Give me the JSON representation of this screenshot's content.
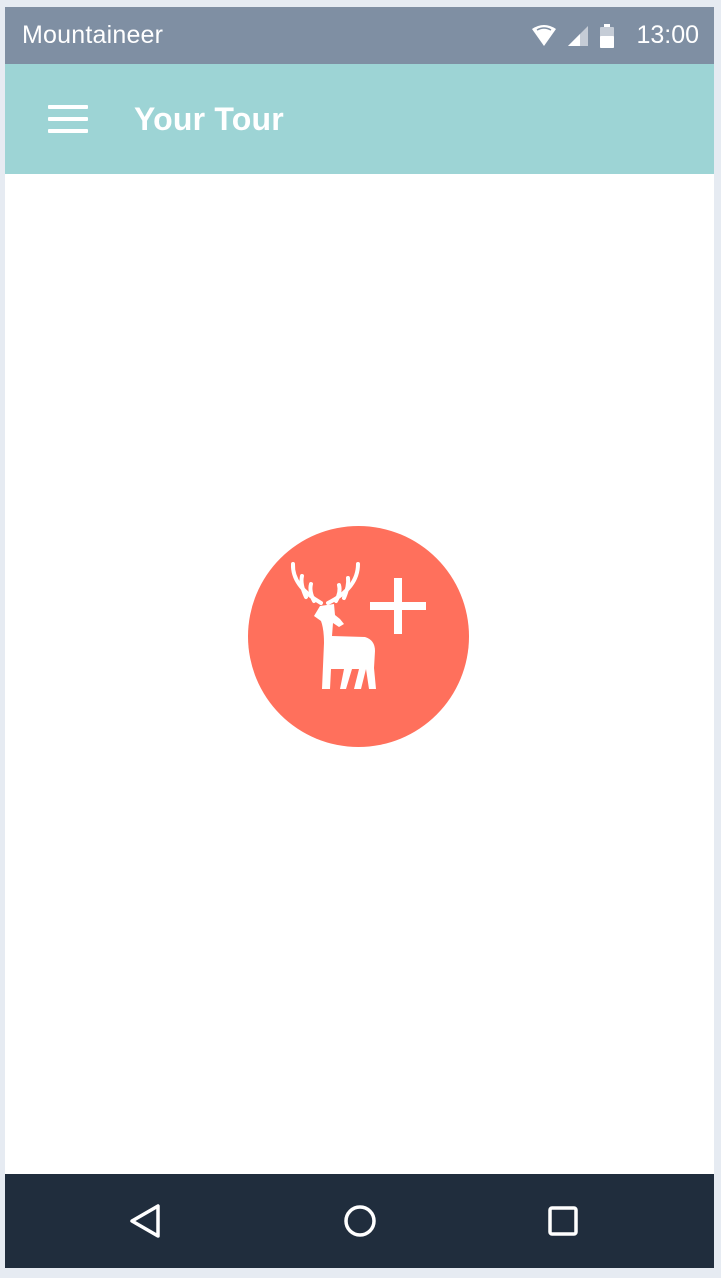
{
  "status_bar": {
    "app_name": "Mountaineer",
    "time": "13:00",
    "icons": [
      "wifi-icon",
      "cellular-signal-icon",
      "battery-icon"
    ],
    "background": "#7f8fa3"
  },
  "app_bar": {
    "title": "Your Tour",
    "menu_icon": "hamburger-menu-icon",
    "background": "#9dd4d5"
  },
  "main": {
    "action_button": {
      "icon": "deer-plus-icon",
      "color": "#ff705c"
    }
  },
  "nav_bar": {
    "buttons": [
      "back-icon",
      "home-icon",
      "recents-icon"
    ],
    "background": "#202d3d"
  }
}
